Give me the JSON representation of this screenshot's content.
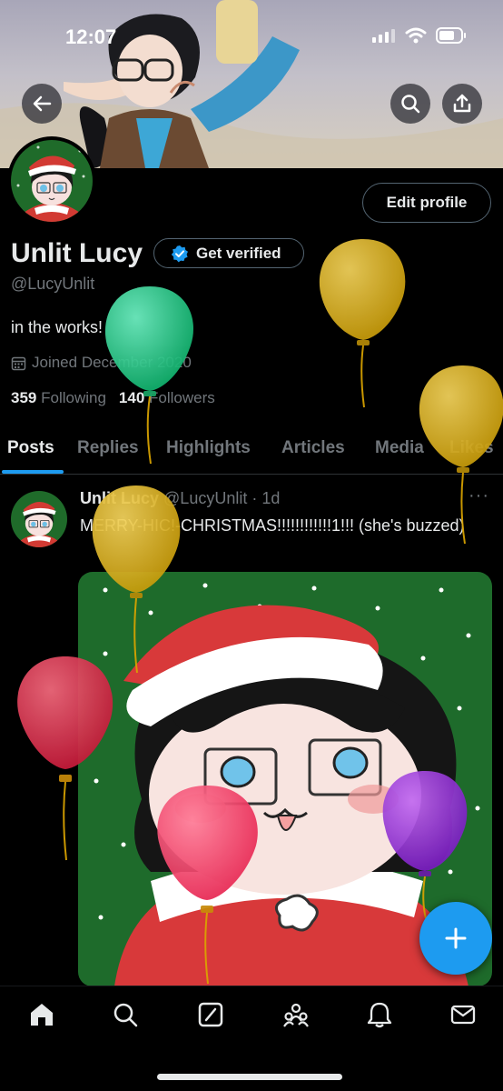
{
  "status_bar": {
    "time": "12:07"
  },
  "header": {
    "back_icon": "back-arrow-icon",
    "search_icon": "search-icon",
    "share_icon": "share-icon"
  },
  "profile": {
    "edit_label": "Edit profile",
    "name": "Unlit Lucy",
    "verify_label": "Get verified",
    "handle": "@LucyUnlit",
    "bio": "in the works!",
    "joined": "Joined December 2020",
    "following_count": "359",
    "following_label": "Following",
    "followers_count": "140",
    "followers_label": "Followers"
  },
  "tabs": [
    "Posts",
    "Replies",
    "Highlights",
    "Articles",
    "Media",
    "Likes"
  ],
  "active_tab": "Posts",
  "post": {
    "author": "Unlit Lucy",
    "handle": "@LucyUnlit",
    "time": "· 1d",
    "text": "MERRY-HIC!-CHRISTMAS!!!!!!!!!!!!1!!! (she's buzzed)",
    "more": "···"
  },
  "nav": [
    "home-icon",
    "search-icon",
    "grok-icon",
    "communities-icon",
    "notifications-icon",
    "messages-icon"
  ],
  "colors": {
    "accent": "#1d9bf0",
    "background": "#000000",
    "text": "#e7e9ea",
    "muted": "#71767b",
    "border": "#2f3336"
  }
}
